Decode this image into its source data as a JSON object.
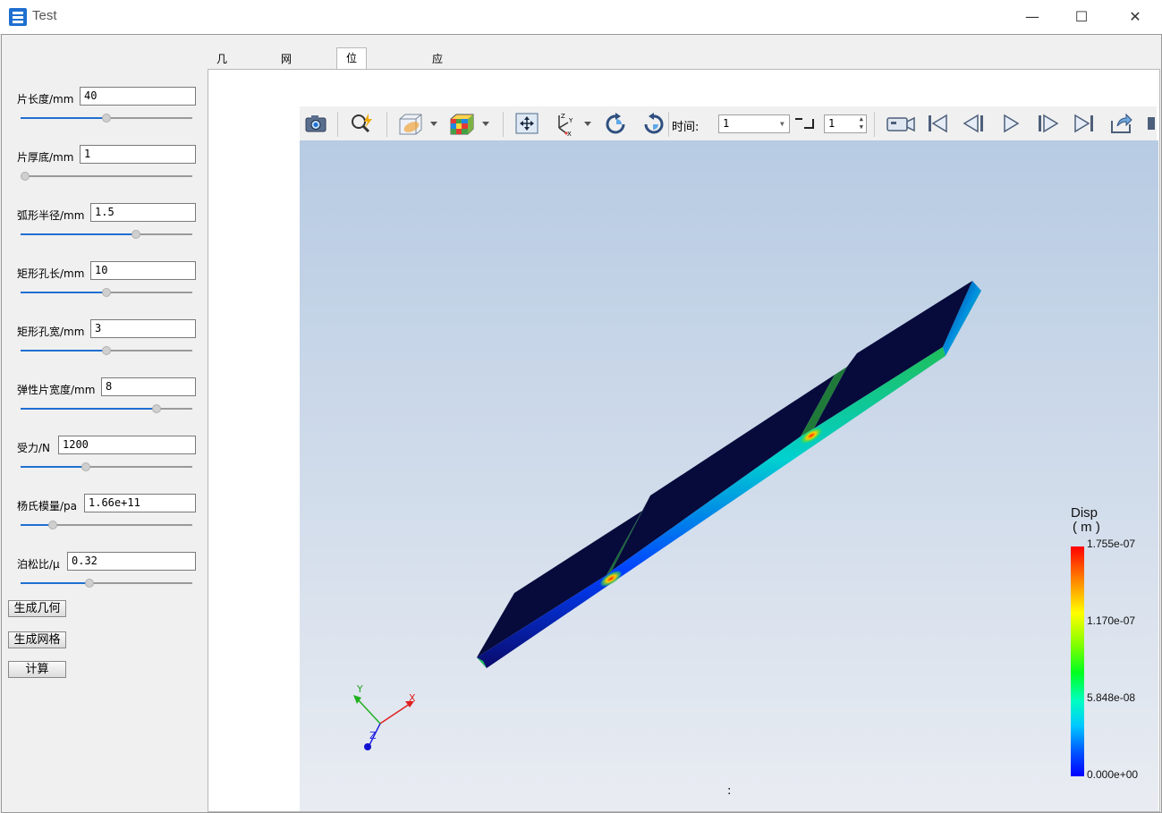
{
  "window": {
    "title": "Test",
    "minimize": "—",
    "maximize": "☐",
    "close": "✕"
  },
  "params": [
    {
      "label": "片长度/mm",
      "value": "40",
      "slider": 0.5
    },
    {
      "label": "片厚底/mm",
      "value": "1",
      "slider": 0.0
    },
    {
      "label": "弧形半径/mm",
      "value": "1.5",
      "slider": 0.67
    },
    {
      "label": "矩形孔长/mm",
      "value": "10",
      "slider": 0.5
    },
    {
      "label": "矩形孔宽/mm",
      "value": "3",
      "slider": 0.5
    },
    {
      "label": "弹性片宽度/mm",
      "value": "8",
      "slider": 0.79
    },
    {
      "label": "受力/N",
      "value": "1200",
      "slider": 0.38
    },
    {
      "label": "杨氏模量/pa",
      "value": "1.66e+11",
      "slider": 0.19
    },
    {
      "label": "泊松比/μ",
      "value": "0.32",
      "slider": 0.4
    }
  ],
  "buttons": {
    "gen_geometry": "生成几何",
    "gen_mesh": "生成网格",
    "compute": "计算"
  },
  "tabs": [
    "几何表单",
    "网格表单",
    "位移云图表单",
    "应力云图表单"
  ],
  "active_tab": 2,
  "toolbar": {
    "time_label": "时间:",
    "time_value": "1",
    "step_value": "1"
  },
  "legend": {
    "title_line1": "Disp",
    "title_line2": "( m )",
    "max": "1.755e-07",
    "mid_high": "1.170e-07",
    "mid_low": "5.848e-08",
    "min": "0.000e+00"
  },
  "axes": {
    "x": "X",
    "y": "Y",
    "z": "Z"
  },
  "viewport_status": ":",
  "colors": {
    "accent": "#1f6fd1",
    "model_dark": "#050a3a"
  },
  "icons": [
    "camera-icon",
    "zoom-icon",
    "clip-icon",
    "cube-color-icon",
    "fit-view-icon",
    "axes-icon",
    "rotate-cw-icon",
    "rotate-ccw-icon",
    "video-icon",
    "first-frame-icon",
    "prev-frame-icon",
    "play-icon",
    "next-frame-icon",
    "last-frame-icon",
    "export-icon"
  ]
}
